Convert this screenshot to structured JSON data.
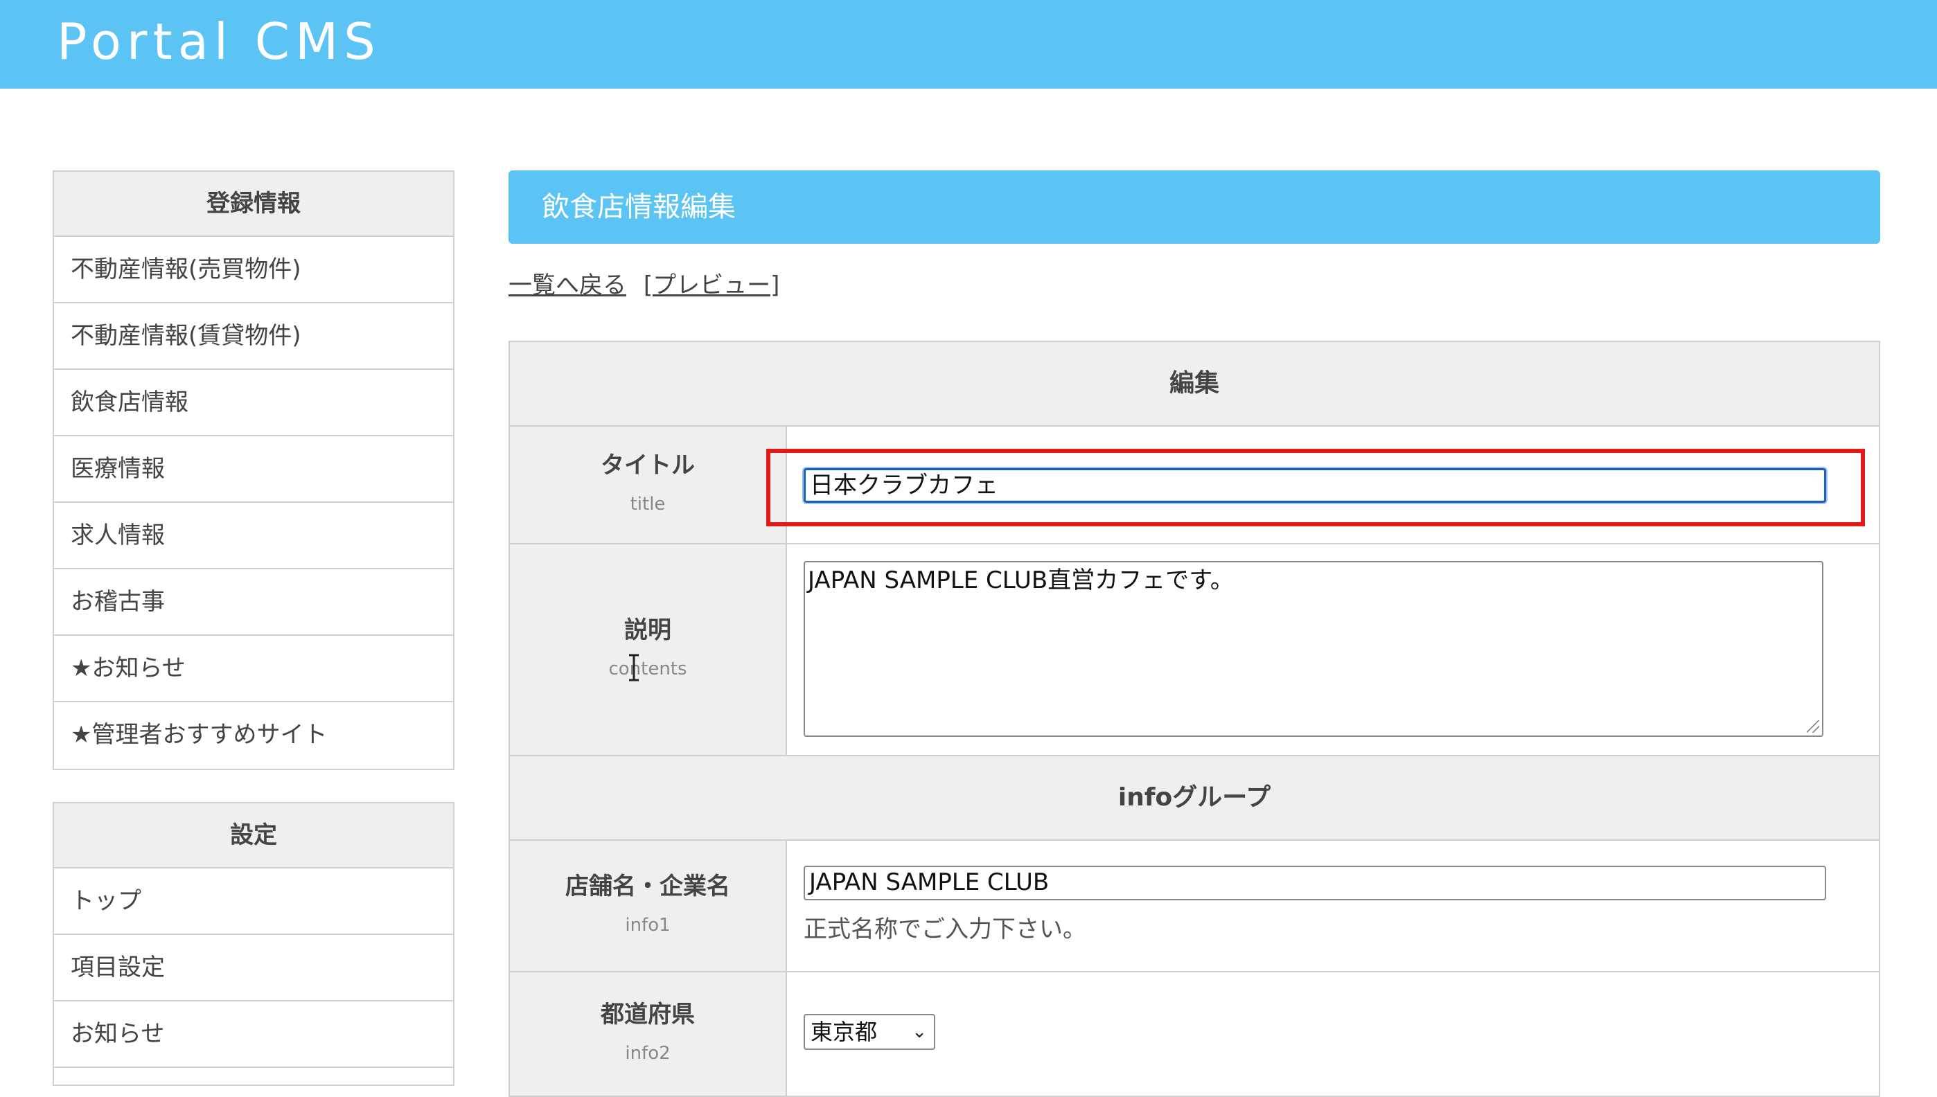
{
  "app": {
    "title": "Portal CMS"
  },
  "sidebar": {
    "main": {
      "header": "登録情報",
      "items": [
        {
          "label": "不動産情報(売買物件)"
        },
        {
          "label": "不動産情報(賃貸物件)"
        },
        {
          "label": "飲食店情報"
        },
        {
          "label": "医療情報"
        },
        {
          "label": "求人情報"
        },
        {
          "label": "お稽古事"
        },
        {
          "label": "★お知らせ"
        },
        {
          "label": "★管理者おすすめサイト"
        }
      ]
    },
    "settings": {
      "header": "設定",
      "items": [
        {
          "label": "トップ"
        },
        {
          "label": "項目設定"
        },
        {
          "label": "お知らせ"
        }
      ]
    }
  },
  "main": {
    "panel_title": "飲食店情報編集",
    "back_link": "一覧へ戻る",
    "preview_link": "[プレビュー]",
    "section_edit": "編集",
    "section_info": "infoグループ",
    "fields": {
      "title": {
        "label": "タイトル",
        "sublabel": "title",
        "value": "日本クラブカフェ"
      },
      "contents": {
        "label": "説明",
        "sublabel": "contents",
        "value": "JAPAN SAMPLE CLUB直営カフェです。"
      },
      "info1": {
        "label": "店舗名・企業名",
        "sublabel": "info1",
        "value": "JAPAN SAMPLE CLUB",
        "hint": "正式名称でご入力下さい。"
      },
      "info2": {
        "label": "都道府県",
        "sublabel": "info2",
        "selected": "東京都"
      }
    }
  },
  "colors": {
    "header_bg": "#5bc4f4",
    "highlight": "#e01a1a",
    "focus_border": "#1a5fb4"
  }
}
